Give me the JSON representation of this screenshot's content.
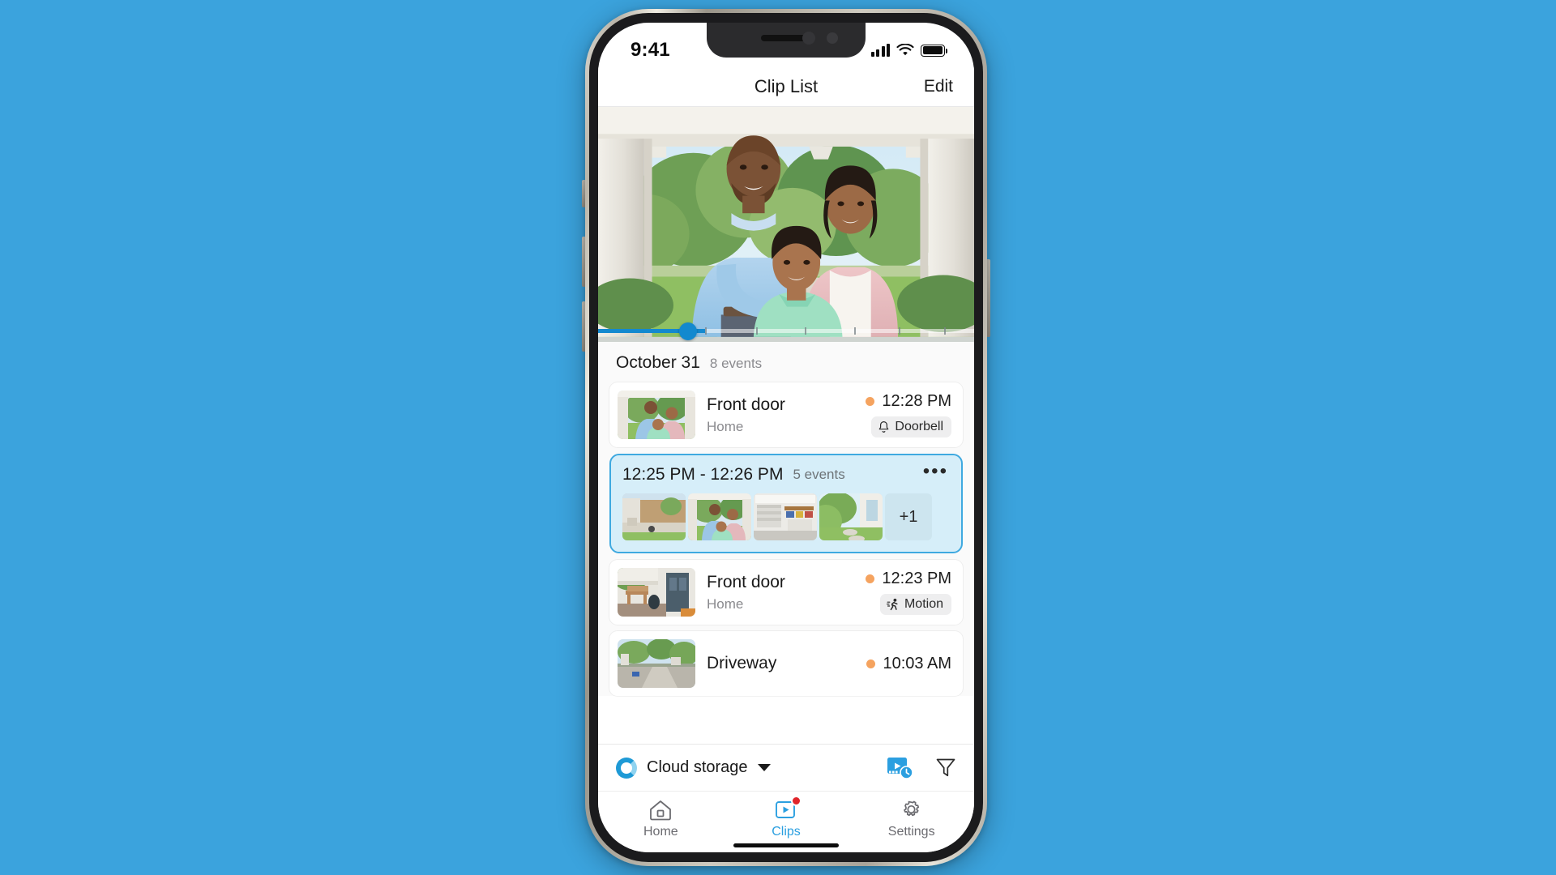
{
  "status_bar": {
    "time": "9:41",
    "cellular_icon": "cellular-signal-icon",
    "wifi_icon": "wifi-icon",
    "battery_icon": "battery-icon"
  },
  "nav": {
    "title": "Clip List",
    "edit_label": "Edit"
  },
  "hero": {
    "scene": "family-on-front-porch",
    "progress_percent": 22
  },
  "date_header": {
    "date": "October 31",
    "event_count": "8 events"
  },
  "clips": [
    {
      "title": "Front door",
      "subtitle": "Home",
      "time": "12:28 PM",
      "badge_label": "Doorbell",
      "badge_icon": "bell-icon",
      "thumbnail": "family-porch",
      "status_color": "#f5a35f"
    },
    {
      "title": "Front door",
      "subtitle": "Home",
      "time": "12:23 PM",
      "badge_label": "Motion",
      "badge_icon": "running-person-icon",
      "thumbnail": "porch-bench-door",
      "status_color": "#f5a35f"
    },
    {
      "title": "Driveway",
      "subtitle": "",
      "time": "10:03 AM",
      "badge_label": "",
      "badge_icon": "",
      "thumbnail": "driveway-street",
      "status_color": "#f5a35f"
    }
  ],
  "group_card": {
    "time_range": "12:25 PM - 12:26 PM",
    "event_count": "5 events",
    "more_icon": "ellipsis-icon",
    "overflow_label": "+1",
    "thumbnails": [
      "backyard-patio",
      "family-porch",
      "garage-interior",
      "side-yard-path"
    ],
    "border_color": "#3fa9e0",
    "background_color": "#d6eef9"
  },
  "toolbar": {
    "cloud_label": "Cloud storage",
    "cloud_icon": "cloud-storage-ring-icon",
    "caret_icon": "chevron-down-icon",
    "timeline_icon": "clip-timeline-icon",
    "filter_icon": "filter-funnel-icon",
    "accent_color": "#1e9ad6"
  },
  "tabs": [
    {
      "label": "Home",
      "icon": "home-icon",
      "active": false,
      "badge": false
    },
    {
      "label": "Clips",
      "icon": "play-clip-icon",
      "active": true,
      "badge": true
    },
    {
      "label": "Settings",
      "icon": "gear-icon",
      "active": false,
      "badge": false
    }
  ],
  "theme": {
    "page_background": "#3ba3dd",
    "accent": "#2b9fe0",
    "badge_red": "#e0252b"
  }
}
